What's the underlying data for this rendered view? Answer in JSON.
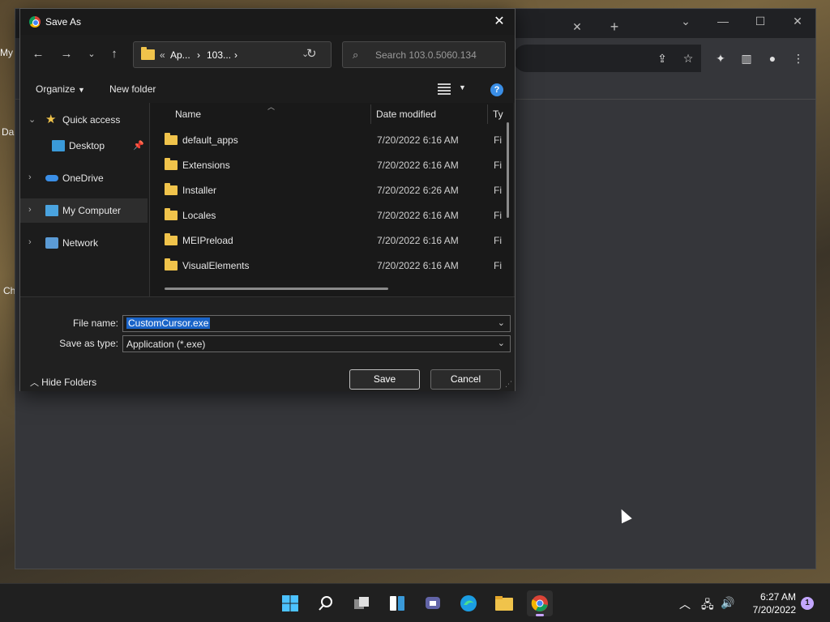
{
  "desktop": {
    "labels": [
      "My",
      "Da",
      "Ch"
    ]
  },
  "chrome": {
    "new_tab": "+",
    "close_tab": "✕"
  },
  "dialog": {
    "title": "Save As",
    "breadcrumb": [
      "Ap...",
      "103..."
    ],
    "search_placeholder": "Search 103.0.5060.134",
    "organize": "Organize",
    "new_folder": "New folder",
    "help": "?",
    "nav_items": [
      {
        "label": "Quick access",
        "icon": "star-icon"
      },
      {
        "label": "Desktop",
        "icon": "desktop-icon"
      },
      {
        "label": "OneDrive",
        "icon": "cloud-icon"
      },
      {
        "label": "My Computer",
        "icon": "computer-icon"
      },
      {
        "label": "Network",
        "icon": "network-icon"
      }
    ],
    "columns": {
      "name": "Name",
      "date": "Date modified",
      "type": "Ty"
    },
    "files": [
      {
        "name": "default_apps",
        "date": "7/20/2022 6:16 AM",
        "type": "Fi"
      },
      {
        "name": "Extensions",
        "date": "7/20/2022 6:16 AM",
        "type": "Fi"
      },
      {
        "name": "Installer",
        "date": "7/20/2022 6:26 AM",
        "type": "Fi"
      },
      {
        "name": "Locales",
        "date": "7/20/2022 6:16 AM",
        "type": "Fi"
      },
      {
        "name": "MEIPreload",
        "date": "7/20/2022 6:16 AM",
        "type": "Fi"
      },
      {
        "name": "VisualElements",
        "date": "7/20/2022 6:16 AM",
        "type": "Fi"
      }
    ],
    "file_name_label": "File name:",
    "file_name_value": "CustomCursor.exe",
    "save_type_label": "Save as type:",
    "save_type_value": "Application (*.exe)",
    "hide_folders": "Hide Folders",
    "save": "Save",
    "cancel": "Cancel"
  },
  "taskbar": {
    "time": "6:27 AM",
    "date": "7/20/2022",
    "notifications": "1"
  }
}
